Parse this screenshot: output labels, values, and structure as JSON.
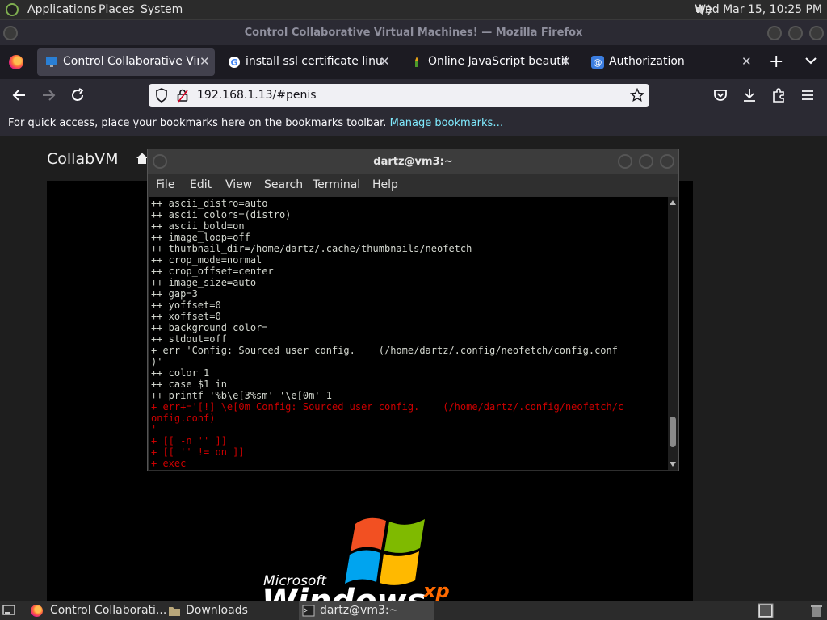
{
  "top_panel": {
    "menus": [
      "Applications",
      "Places",
      "System"
    ],
    "clock": "Wed Mar 15, 10:25 PM"
  },
  "window": {
    "title": "Control Collaborative Virtual Machines! — Mozilla Firefox"
  },
  "tabs": [
    {
      "label": "Control Collaborative Virtual",
      "active": true,
      "icon": "monitor-icon"
    },
    {
      "label": "install ssl certificate linux - G",
      "active": false,
      "icon": "google-icon"
    },
    {
      "label": "Online JavaScript beautifier",
      "active": false,
      "icon": "beautifier-icon"
    },
    {
      "label": "Authorization",
      "active": false,
      "icon": "at-icon"
    }
  ],
  "url": "192.168.1.13/#penis",
  "bookmarks_bar": {
    "message": "For quick access, place your bookmarks here on the bookmarks toolbar.",
    "link": "Manage bookmarks…"
  },
  "page": {
    "site_title": "CollabVM",
    "xp_brand": "Microsoft",
    "xp_windows": "Windows",
    "xp_suffix": "xp"
  },
  "terminal": {
    "title": "dartz@vm3:~",
    "menu": [
      "File",
      "Edit",
      "View",
      "Search",
      "Terminal",
      "Help"
    ],
    "lines": [
      {
        "text": "++ ascii_distro=auto",
        "color": "normal"
      },
      {
        "text": "++ ascii_colors=(distro)",
        "color": "normal"
      },
      {
        "text": "++ ascii_bold=on",
        "color": "normal"
      },
      {
        "text": "++ image_loop=off",
        "color": "normal"
      },
      {
        "text": "++ thumbnail_dir=/home/dartz/.cache/thumbnails/neofetch",
        "color": "normal"
      },
      {
        "text": "++ crop_mode=normal",
        "color": "normal"
      },
      {
        "text": "++ crop_offset=center",
        "color": "normal"
      },
      {
        "text": "++ image_size=auto",
        "color": "normal"
      },
      {
        "text": "++ gap=3",
        "color": "normal"
      },
      {
        "text": "++ yoffset=0",
        "color": "normal"
      },
      {
        "text": "++ xoffset=0",
        "color": "normal"
      },
      {
        "text": "++ background_color=",
        "color": "normal"
      },
      {
        "text": "++ stdout=off",
        "color": "normal"
      },
      {
        "text": "+ err 'Config: Sourced user config.    (/home/dartz/.config/neofetch/config.conf",
        "color": "normal"
      },
      {
        "text": ")'",
        "color": "normal"
      },
      {
        "text": "++ color 1",
        "color": "normal"
      },
      {
        "text": "++ case $1 in",
        "color": "normal"
      },
      {
        "text": "++ printf '%b\\e[3%sm' '\\e[0m' 1",
        "color": "normal"
      },
      {
        "text": "+ err+='[!] \\e[0m Config: Sourced user config.    (/home/dartz/.config/neofetch/c",
        "color": "red"
      },
      {
        "text": "onfig.conf)",
        "color": "red"
      },
      {
        "text": "'",
        "color": "red"
      },
      {
        "text": "+ [[ -n '' ]]",
        "color": "red"
      },
      {
        "text": "+ [[ '' != on ]]",
        "color": "red"
      },
      {
        "text": "+ exec",
        "color": "red"
      }
    ]
  },
  "taskbar": [
    {
      "label": "Control Collaborati...",
      "active": false,
      "icon": "firefox-icon"
    },
    {
      "label": "Downloads",
      "active": false,
      "icon": "folder-icon"
    },
    {
      "label": "dartz@vm3:~",
      "active": true,
      "icon": "terminal-icon"
    }
  ]
}
